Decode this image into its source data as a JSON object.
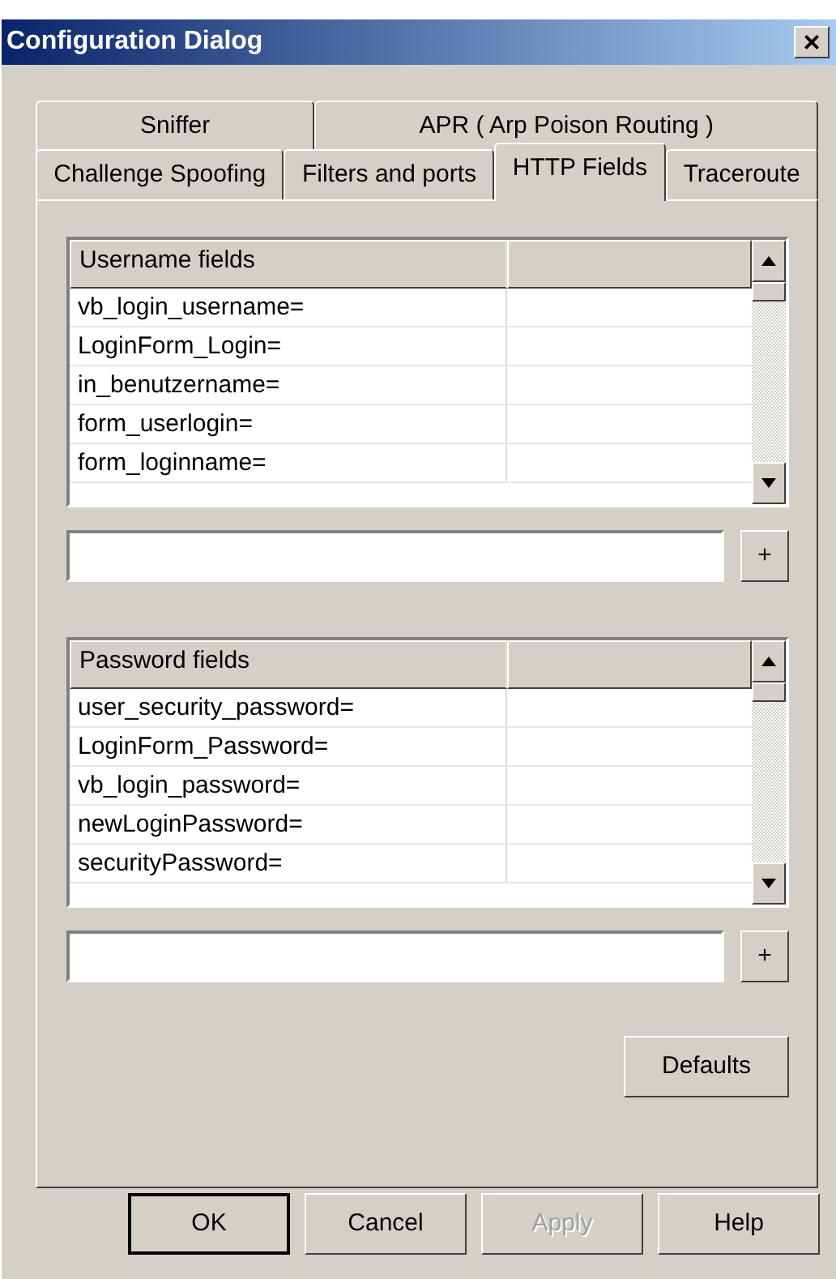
{
  "window": {
    "title": "Configuration Dialog",
    "close": "×"
  },
  "tab_rows": [
    [
      {
        "label": "Sniffer",
        "selected": false
      },
      {
        "label": "APR ( Arp Poison Routing )",
        "selected": false
      }
    ],
    [
      {
        "label": "Challenge Spoofing",
        "selected": false
      },
      {
        "label": "Filters and ports",
        "selected": false
      },
      {
        "label": "HTTP Fields",
        "selected": true
      },
      {
        "label": "Traceroute",
        "selected": false
      }
    ]
  ],
  "lists": [
    {
      "header": "Username fields",
      "rows": [
        "vb_login_username=",
        "LoginForm_Login=",
        "in_benutzername=",
        "form_userlogin=",
        "form_loginname="
      ],
      "add_button": "+"
    },
    {
      "header": "Password fields",
      "rows": [
        "user_security_password=",
        "LoginForm_Password=",
        "vb_login_password=",
        "newLoginPassword=",
        "securityPassword="
      ],
      "add_button": "+"
    }
  ],
  "defaults_button": "Defaults",
  "buttons": [
    {
      "label": "OK",
      "default": true,
      "disabled": false
    },
    {
      "label": "Cancel",
      "default": false,
      "disabled": false
    },
    {
      "label": "Apply",
      "default": false,
      "disabled": true
    },
    {
      "label": "Help",
      "default": false,
      "disabled": false
    }
  ]
}
